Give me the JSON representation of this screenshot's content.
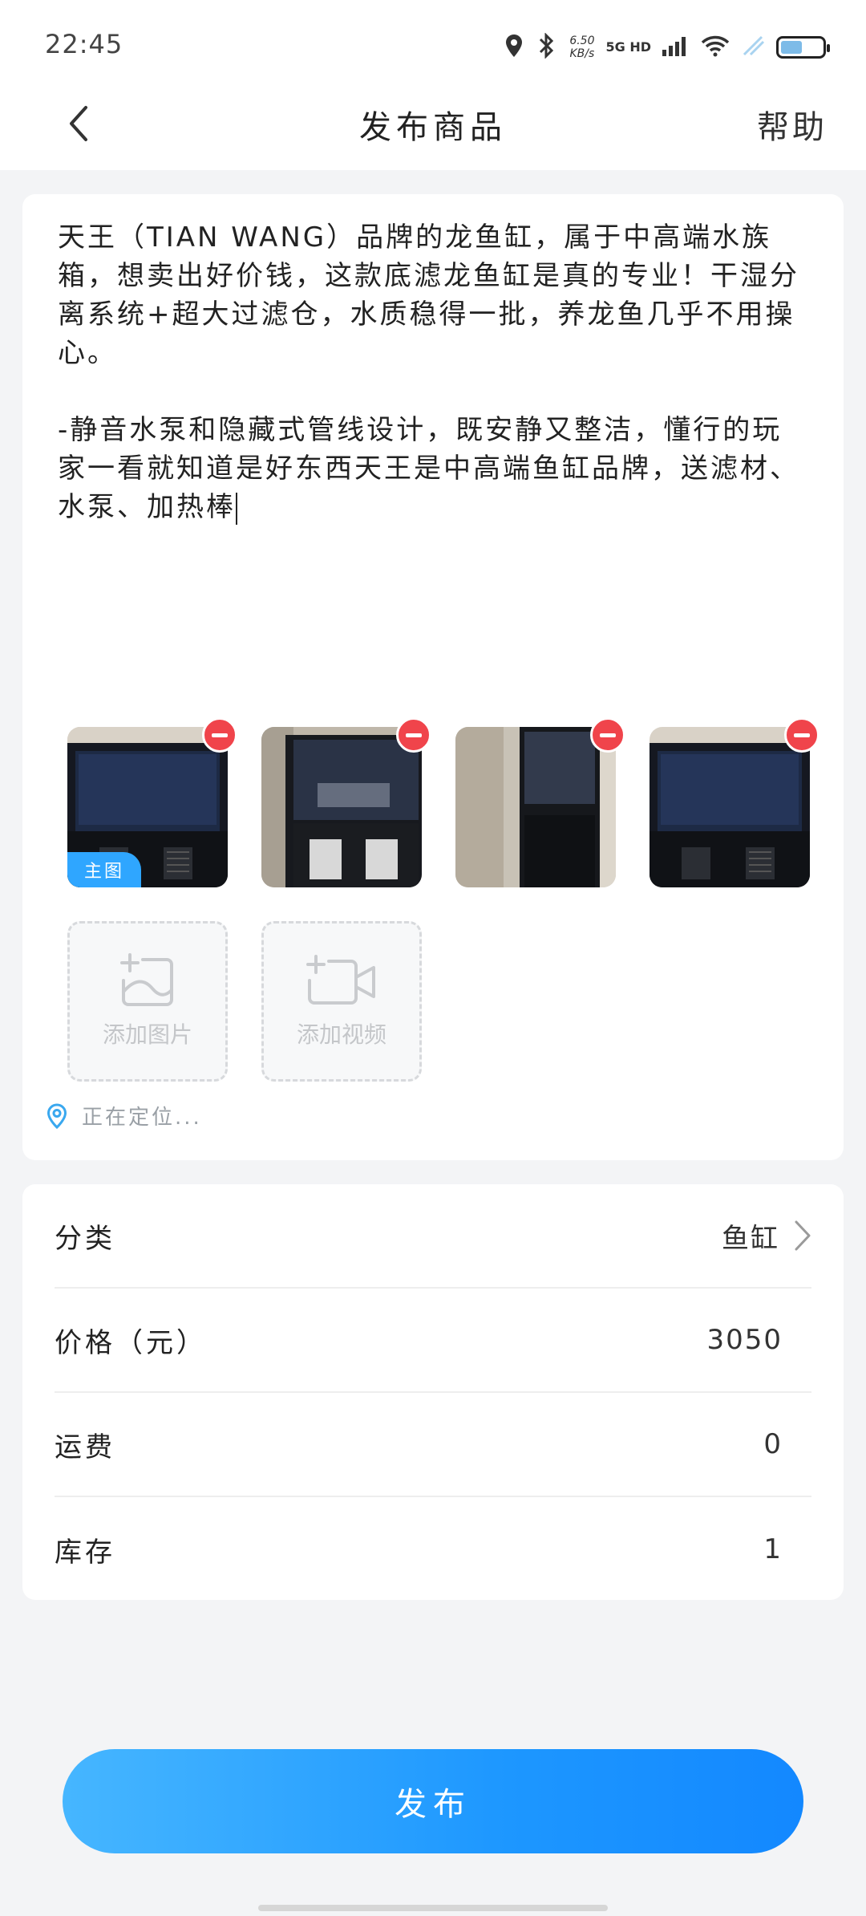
{
  "status_bar": {
    "time": "22:45",
    "net_speed": "6.50\nKB/s",
    "network": "5G HD",
    "icons": [
      "location-icon",
      "bluetooth-icon",
      "signal-icon",
      "wifi-icon",
      "battery-icon"
    ]
  },
  "header": {
    "back_icon": "chevron-left-icon",
    "title": "发布商品",
    "help": "帮助"
  },
  "description": {
    "text": "天王（TIAN WANG）品牌的龙鱼缸，属于中高端水族箱，想卖出好价钱，这款底滤龙鱼缸是真的专业！干湿分离系统+超大过滤仓，水质稳得一批，养龙鱼几乎不用操心。\n\n-静音水泵和隐藏式管线设计，既安静又整洁，懂行的玩家一看就知道是好东西天王是中高端鱼缸品牌，送滤材、水泵、加热棒"
  },
  "photos": [
    {
      "badge": "主图"
    },
    {},
    {},
    {}
  ],
  "add_tiles": {
    "photo_label": "添加图片",
    "video_label": "添加视频"
  },
  "location": {
    "text": "正在定位..."
  },
  "fields": {
    "category_label": "分类",
    "category_value": "鱼缸",
    "price_label": "价格（元）",
    "price_value": "3050",
    "shipping_label": "运费",
    "shipping_value": "0",
    "stock_label": "库存",
    "stock_value": "1"
  },
  "publish_button": "发布",
  "colors": {
    "accent": "#1d97ff",
    "remove": "#f0444b",
    "badge": "#2fa6ff"
  }
}
